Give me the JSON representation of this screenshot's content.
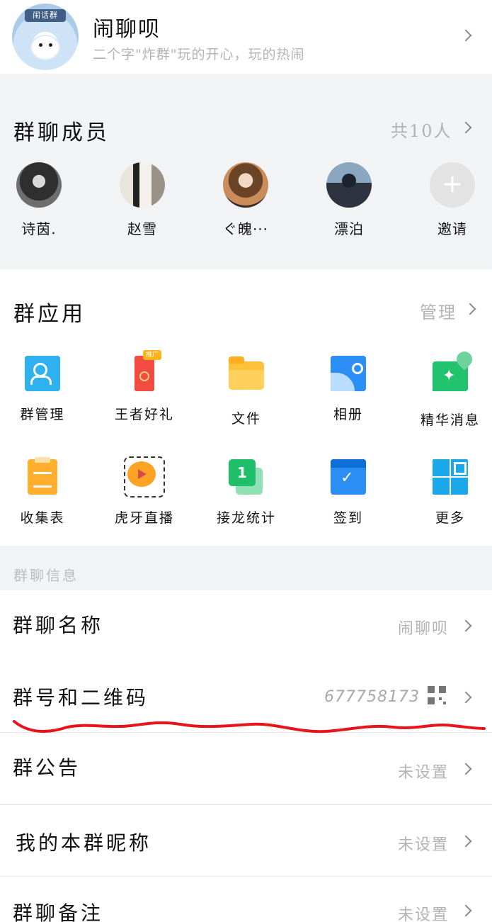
{
  "group": {
    "avatar_badge": "闹话群",
    "name": "闹聊呗",
    "description": "二个字\"炸群\"玩的开心，玩的热闹"
  },
  "members": {
    "title": "群聊成员",
    "count": "共10人",
    "list": [
      {
        "name": "诗茵."
      },
      {
        "name": "赵雪"
      },
      {
        "name": "ぐ魄···"
      },
      {
        "name": "漂泊"
      }
    ],
    "invite": "邀请"
  },
  "apps": {
    "title": "群应用",
    "manage": "管理",
    "items": [
      {
        "label": "群管理",
        "icon": "group-manage-icon"
      },
      {
        "label": "王者好礼",
        "icon": "gift-icon",
        "badge": "推广"
      },
      {
        "label": "文件",
        "icon": "folder-icon"
      },
      {
        "label": "相册",
        "icon": "photo-album-icon"
      },
      {
        "label": "精华消息",
        "icon": "essence-message-icon"
      },
      {
        "label": "收集表",
        "icon": "form-icon"
      },
      {
        "label": "虎牙直播",
        "icon": "tiger-live-icon"
      },
      {
        "label": "接龙统计",
        "icon": "relay-count-icon"
      },
      {
        "label": "签到",
        "icon": "checkin-icon"
      },
      {
        "label": "更多",
        "icon": "more-grid-icon"
      }
    ]
  },
  "info": {
    "section_title": "群聊信息",
    "rows": [
      {
        "label": "群聊名称",
        "value": "闹聊呗"
      },
      {
        "label": "群号和二维码",
        "value": "677758173"
      },
      {
        "label": "群公告",
        "value": "未设置"
      },
      {
        "label": "我的本群昵称",
        "value": "未设置"
      },
      {
        "label": "群聊备注",
        "value": "未设置"
      }
    ]
  },
  "colors": {
    "annotation_line": "#e8141b",
    "section_bg": "#f2f3f5",
    "secondary_text": "#b3b3b3"
  }
}
